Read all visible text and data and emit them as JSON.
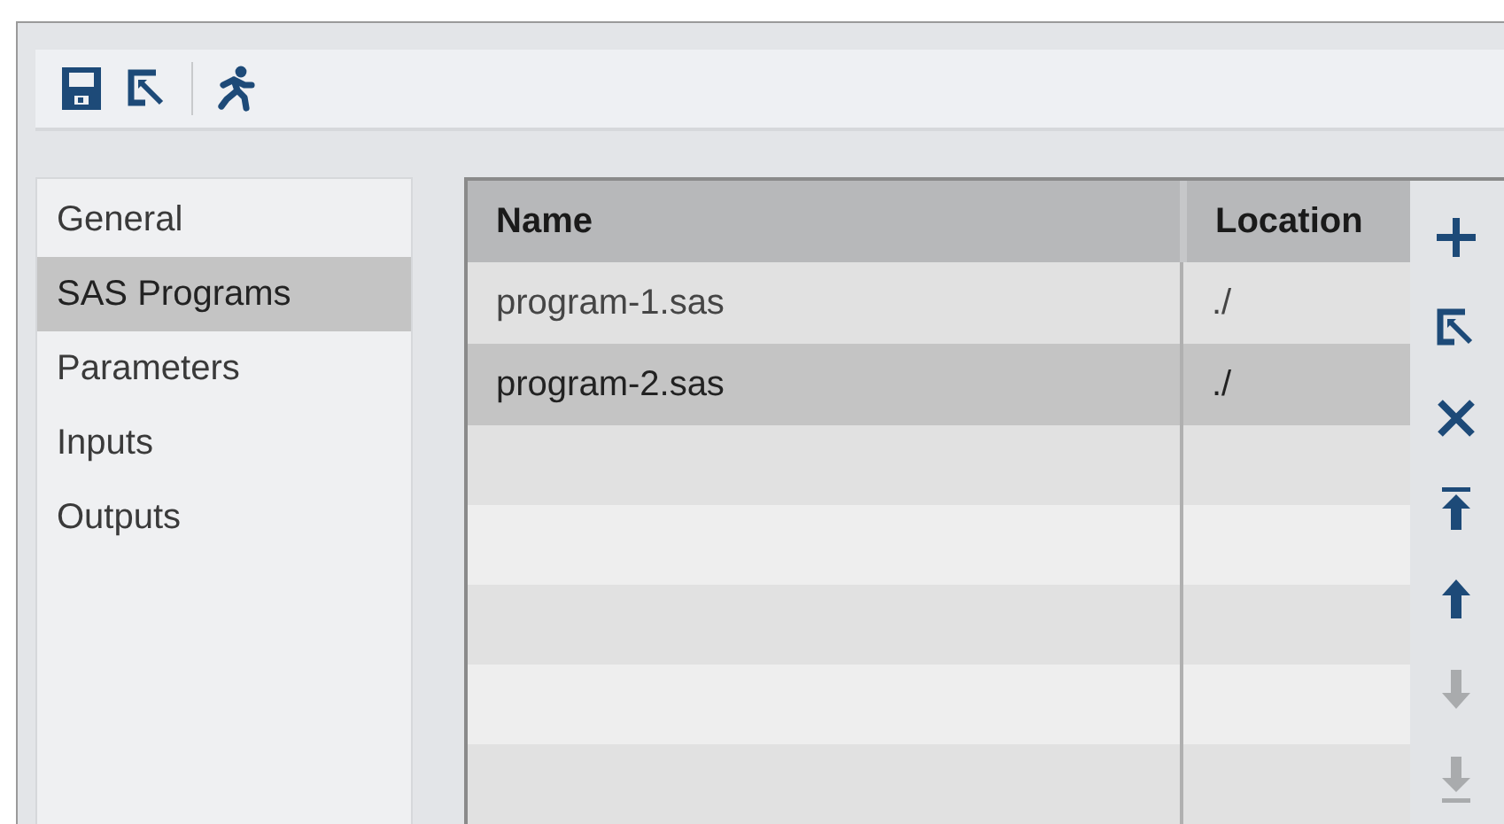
{
  "toolbar": {
    "buttons": [
      {
        "kind": "save"
      },
      {
        "kind": "edit"
      },
      {
        "kind": "run"
      }
    ]
  },
  "sidebar": {
    "items": [
      {
        "label": "General",
        "selected": false
      },
      {
        "label": "SAS Programs",
        "selected": true
      },
      {
        "label": "Parameters",
        "selected": false
      },
      {
        "label": "Inputs",
        "selected": false
      },
      {
        "label": "Outputs",
        "selected": false
      }
    ]
  },
  "table": {
    "columns": [
      "Name",
      "Location"
    ],
    "rows": [
      {
        "cells": [
          "program-1.sas",
          "./"
        ],
        "selected": false
      },
      {
        "cells": [
          "program-2.sas",
          "./"
        ],
        "selected": true
      }
    ]
  },
  "actions": [
    {
      "kind": "add",
      "disabled": false
    },
    {
      "kind": "edit",
      "disabled": false
    },
    {
      "kind": "delete",
      "disabled": false
    },
    {
      "kind": "move-top",
      "disabled": false
    },
    {
      "kind": "move-up",
      "disabled": false
    },
    {
      "kind": "move-down",
      "disabled": true
    },
    {
      "kind": "move-bottom",
      "disabled": true
    }
  ]
}
